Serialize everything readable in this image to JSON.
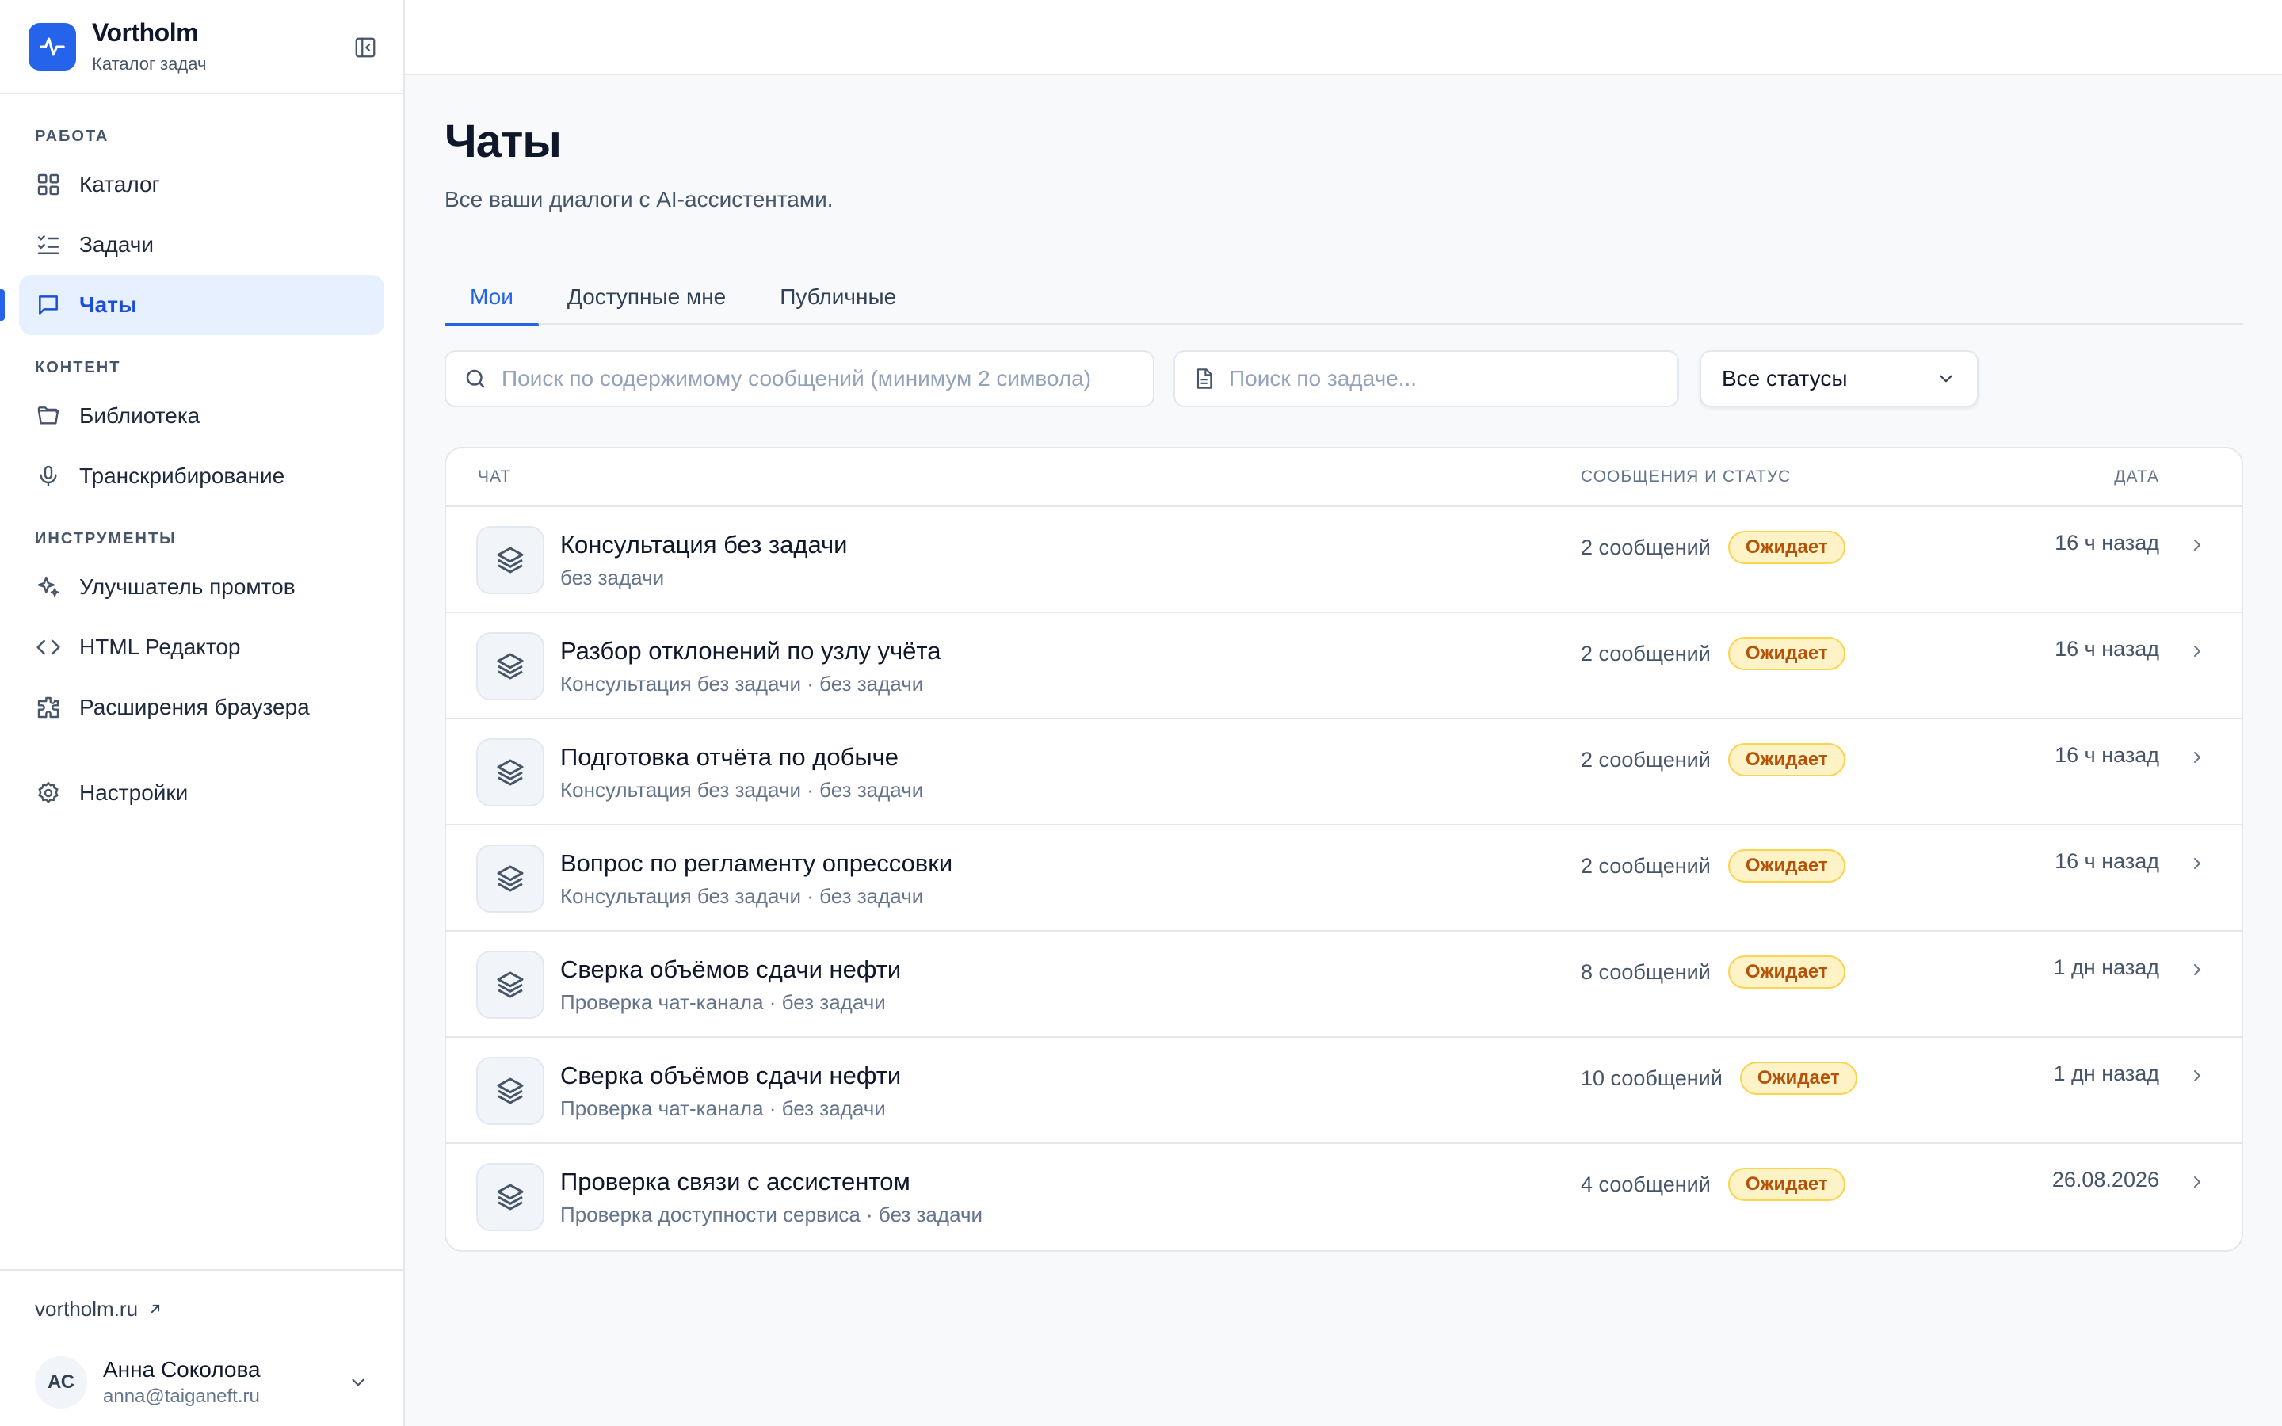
{
  "brand": {
    "name": "Vortholm",
    "subtitle": "Каталог задач",
    "accent": "#2563eb"
  },
  "sidebar": {
    "sections": [
      {
        "label": "РАБОТА",
        "items": [
          {
            "icon": "grid-icon",
            "label": "Каталог"
          },
          {
            "icon": "list-checks-icon",
            "label": "Задачи"
          },
          {
            "icon": "chat-icon",
            "label": "Чаты",
            "active": true
          }
        ]
      },
      {
        "label": "КОНТЕНТ",
        "items": [
          {
            "icon": "folder-open-icon",
            "label": "Библиотека"
          },
          {
            "icon": "microphone-icon",
            "label": "Транскрибирование"
          }
        ]
      },
      {
        "label": "ИНСТРУМЕНТЫ",
        "items": [
          {
            "icon": "sparkles-icon",
            "label": "Улучшатель промтов"
          },
          {
            "icon": "code-icon",
            "label": "HTML Редактор"
          },
          {
            "icon": "puzzle-icon",
            "label": "Расширения браузера"
          }
        ]
      }
    ],
    "settings": {
      "icon": "gear-icon",
      "label": "Настройки"
    },
    "external_link": "vortholm.ru",
    "user": {
      "initials": "АС",
      "name": "Анна Соколова",
      "email": "anna@taiganeft.ru"
    }
  },
  "page": {
    "title": "Чаты",
    "subtitle": "Все ваши диалоги с AI-ассистентами.",
    "tabs": [
      {
        "label": "Мои",
        "active": true
      },
      {
        "label": "Доступные мне"
      },
      {
        "label": "Публичные"
      }
    ],
    "filters": {
      "message_search_placeholder": "Поиск по содержимому сообщений (минимум 2 символа)",
      "message_search_value": "",
      "task_search_placeholder": "Поиск по задаче...",
      "task_search_value": "",
      "status_selected": "Все статусы"
    }
  },
  "table": {
    "headers": {
      "chat": "ЧАТ",
      "messages": "СООБЩЕНИЯ И СТАТУС",
      "date": "ДАТА"
    },
    "rows": [
      {
        "title": "Консультация без задачи",
        "subtitle": "без задачи",
        "messages": "2 сообщений",
        "status": "Ожидает",
        "date": "16 ч назад"
      },
      {
        "title": "Разбор отклонений по узлу учёта",
        "subtitle": "Консультация без задачи · без задачи",
        "messages": "2 сообщений",
        "status": "Ожидает",
        "date": "16 ч назад"
      },
      {
        "title": "Подготовка отчёта по добыче",
        "subtitle": "Консультация без задачи · без задачи",
        "messages": "2 сообщений",
        "status": "Ожидает",
        "date": "16 ч назад"
      },
      {
        "title": "Вопрос по регламенту опрессовки",
        "subtitle": "Консультация без задачи · без задачи",
        "messages": "2 сообщений",
        "status": "Ожидает",
        "date": "16 ч назад"
      },
      {
        "title": "Сверка объёмов сдачи нефти",
        "subtitle": "Проверка чат-канала · без задачи",
        "messages": "8 сообщений",
        "status": "Ожидает",
        "date": "1 дн назад"
      },
      {
        "title": "Сверка объёмов сдачи нефти",
        "subtitle": "Проверка чат-канала · без задачи",
        "messages": "10 сообщений",
        "status": "Ожидает",
        "date": "1 дн назад"
      },
      {
        "title": "Проверка связи с ассистентом",
        "subtitle": "Проверка доступности сервиса · без задачи",
        "messages": "4 сообщений",
        "status": "Ожидает",
        "date": "26.08.2026"
      }
    ],
    "status_colors": {
      "bg": "#fef3c7",
      "border": "#fcd34d",
      "text": "#b45309"
    }
  }
}
